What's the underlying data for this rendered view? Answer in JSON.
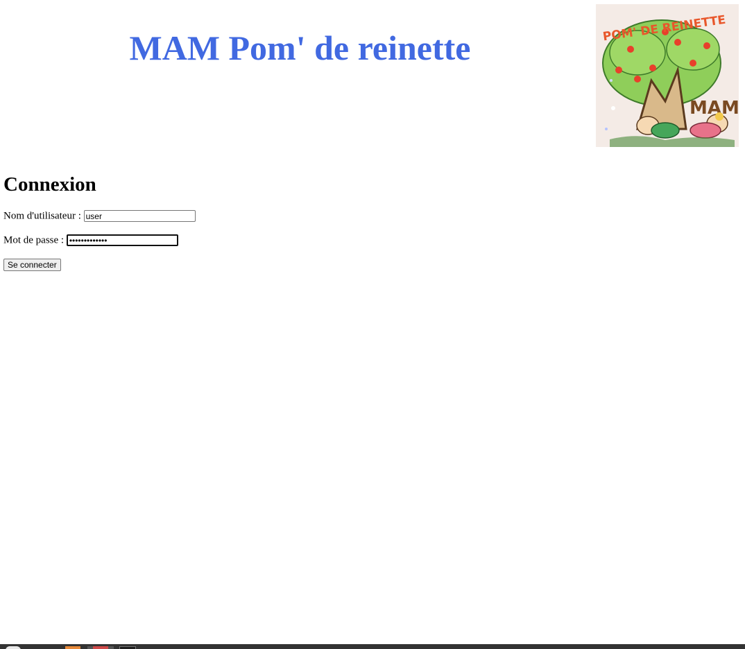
{
  "header": {
    "title": "MAM Pom' de reinette",
    "logo_alt": "POM' DE REINETTE MAM",
    "logo_text": "POM' DE REINETTE",
    "logo_monogram": "MAM"
  },
  "login": {
    "heading": "Connexion",
    "username_label": "Nom d'utilisateur :",
    "username_value": "user",
    "password_label": "Mot de passe :",
    "password_value": "•••••••••••••",
    "submit_label": "Se connecter"
  },
  "colors": {
    "title": "#4169e1",
    "taskbar": "#333333"
  },
  "taskbar": {
    "items": [
      "start-icon",
      "app-icon-orange",
      "app-icon-red",
      "app-icon-terminal"
    ]
  }
}
